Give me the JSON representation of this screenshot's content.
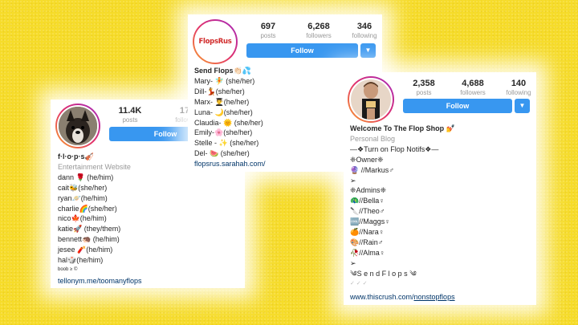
{
  "card1": {
    "stats": [
      {
        "num": "11.4K",
        "label": "posts"
      },
      {
        "num": "17K",
        "label": "followers"
      }
    ],
    "follow_label": "Follow",
    "name": "f·l·o·p·s🎻",
    "category": "Entertainment Website",
    "bio_lines": [
      "dann 🌹 (he/him)",
      "cait🐝(she/her)",
      "ryan🪐(he/him)",
      "charlie🌈(she/her)",
      "nico🍁(he/him)",
      "katie🚀 (they/them)",
      "bennett🦔 (he/him)",
      "jesee 🧨(he/him)",
      "hal🎲(he/him)"
    ],
    "tiny": "boob ≥ ©",
    "link": "tellonym.me/toomanyflops"
  },
  "card2": {
    "logo": "FlopsRus",
    "stats": [
      {
        "num": "697",
        "label": "posts"
      },
      {
        "num": "6,268",
        "label": "followers"
      },
      {
        "num": "346",
        "label": "following"
      }
    ],
    "follow_label": "Follow",
    "name": "Send Flops👏🏻💦",
    "bio_lines": [
      "Mary- 🧚 (she/her)",
      "Dill-💃(she/her)",
      "Marx- 👨‍🎓(he/her)",
      "Luna- 🌙(she/her)",
      "Claudia- 🌞 (she/her)",
      "Emily-🌸(she/her)",
      "Stelle - ✨ (she/her)",
      "Del- 🍉 (she/her)"
    ],
    "link": "flopsrus.sarahah.com/"
  },
  "card3": {
    "stats": [
      {
        "num": "2,358",
        "label": "posts"
      },
      {
        "num": "4,688",
        "label": "followers"
      },
      {
        "num": "140",
        "label": "following"
      }
    ],
    "follow_label": "Follow",
    "name": "Welcome To The Flop Shop 💅",
    "category": "Personal Blog",
    "bio_lines": [
      "—❖Turn on Flop Notifs❖—",
      "❈Owner❈",
      "🔮 //Markus♂",
      "➢",
      "❈Admins❈",
      "🦚//Bella♀",
      "🔪//Theo♂",
      "🆒//Maggs♀",
      "🍊//Nara♀",
      "🎨//Rain♂",
      "🥀//Alma♀",
      "➢",
      "༄S e n d F l o p s ༄",
      "✓ ✓ ✓"
    ],
    "link_prefix": "www.thiscrush.com/",
    "link_handle": "nonstopflops"
  },
  "colors": {
    "background": "#f6dc2a",
    "follow_button": "#3897f0",
    "link": "#003569",
    "muted": "#999999"
  }
}
